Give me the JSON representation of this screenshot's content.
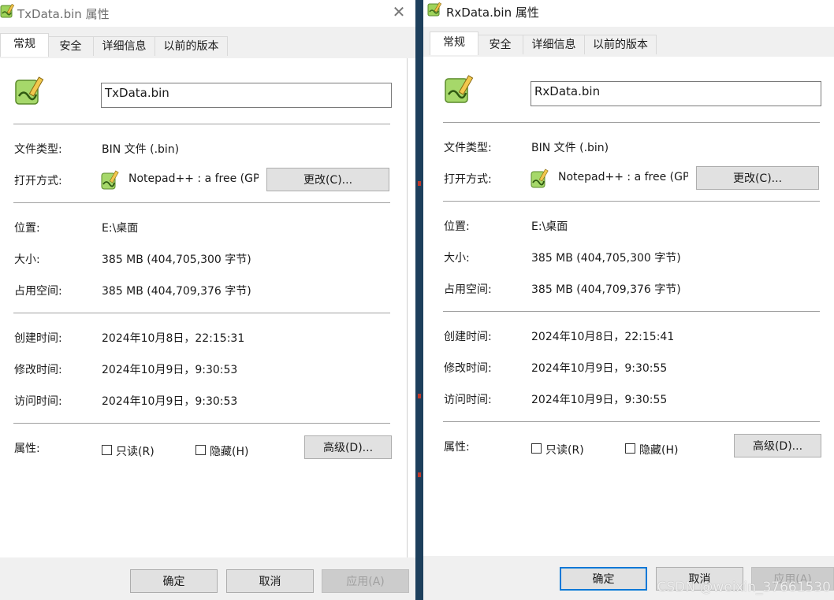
{
  "left": {
    "title": "TxData.bin 属性",
    "tabs": [
      "常规",
      "安全",
      "详细信息",
      "以前的版本"
    ],
    "filename": "TxData.bin",
    "labels": {
      "file_type": "文件类型:",
      "open_with": "打开方式:",
      "location": "位置:",
      "size": "大小:",
      "size_on_disk": "占用空间:",
      "created": "创建时间:",
      "modified": "修改时间:",
      "accessed": "访问时间:",
      "attributes": "属性:"
    },
    "file_type": "BIN 文件 (.bin)",
    "open_with": "Notepad++ : a free (GPL) source code editor",
    "change_button": "更改(C)...",
    "location": "E:\\桌面",
    "size": "385 MB (404,705,300 字节)",
    "size_on_disk": "385 MB (404,709,376 字节)",
    "created": "2024年10月8日，22:15:31",
    "modified": "2024年10月9日，9:30:53",
    "accessed": "2024年10月9日，9:30:53",
    "readonly": "只读(R)",
    "hidden": "隐藏(H)",
    "advanced_button": "高级(D)...",
    "ok": "确定",
    "cancel": "取消",
    "apply": "应用(A)",
    "close": "✕"
  },
  "right": {
    "title": "RxData.bin 属性",
    "tabs": [
      "常规",
      "安全",
      "详细信息",
      "以前的版本"
    ],
    "filename": "RxData.bin",
    "labels": {
      "file_type": "文件类型:",
      "open_with": "打开方式:",
      "location": "位置:",
      "size": "大小:",
      "size_on_disk": "占用空间:",
      "created": "创建时间:",
      "modified": "修改时间:",
      "accessed": "访问时间:",
      "attributes": "属性:"
    },
    "file_type": "BIN 文件 (.bin)",
    "open_with": "Notepad++ : a free (GPL) source code editor",
    "change_button": "更改(C)...",
    "location": "E:\\桌面",
    "size": "385 MB (404,705,300 字节)",
    "size_on_disk": "385 MB (404,709,376 字节)",
    "created": "2024年10月8日，22:15:41",
    "modified": "2024年10月9日，9:30:55",
    "accessed": "2024年10月9日，9:30:55",
    "readonly": "只读(R)",
    "hidden": "隐藏(H)",
    "advanced_button": "高级(D)...",
    "ok": "确定",
    "cancel": "取消",
    "apply": "应用(A)"
  },
  "watermark": "CSDN @weixin_37661530",
  "icons": {
    "app": "notepadplusplus-icon",
    "file": "notepadplusplus-file-icon",
    "close": "close-icon"
  },
  "colors": {
    "accent": "#0078d7",
    "tab_bg": "#f0f0f0"
  }
}
